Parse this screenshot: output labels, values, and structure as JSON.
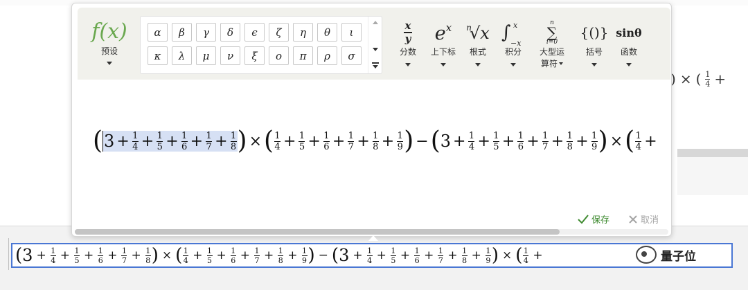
{
  "toolbar": {
    "preset": {
      "icon": "f(x)",
      "label": "预设"
    },
    "symbols": [
      "α",
      "β",
      "γ",
      "δ",
      "ϵ",
      "ζ",
      "η",
      "θ",
      "ι",
      "κ",
      "λ",
      "μ",
      "ν",
      "ξ",
      "ο",
      "π",
      "ρ",
      "σ"
    ],
    "buttons": [
      {
        "name": "fraction",
        "label": "分数"
      },
      {
        "name": "script",
        "label": "上下标"
      },
      {
        "name": "radical",
        "label": "根式"
      },
      {
        "name": "integral",
        "label": "积分"
      },
      {
        "name": "large-operator",
        "label": "大型运算符"
      },
      {
        "name": "bracket",
        "label": "括号"
      },
      {
        "name": "function",
        "label": "函数",
        "icon": "sinθ"
      }
    ]
  },
  "formula": {
    "group1": {
      "lead": "3",
      "denoms": [
        "4",
        "5",
        "6",
        "7",
        "8"
      ]
    },
    "group2": {
      "denoms": [
        "4",
        "5",
        "6",
        "7",
        "8",
        "9"
      ]
    },
    "group3": {
      "lead": "3",
      "denoms": [
        "4",
        "5",
        "6",
        "7",
        "8",
        "9"
      ]
    },
    "group4_partial": {
      "denoms": [
        "4"
      ]
    },
    "numerator": "1",
    "ops": {
      "plus": "+",
      "times": "×",
      "minus": "−"
    }
  },
  "actions": {
    "save": "保存",
    "cancel": "取消"
  },
  "watermark": "量子位",
  "icons": {
    "save": "check-icon",
    "cancel": "x-icon",
    "watermark": "wechat-icon"
  },
  "colors": {
    "accent_green": "#3e8a2f",
    "selection": "#d6e0f4",
    "focus_border": "#4a77d4"
  }
}
